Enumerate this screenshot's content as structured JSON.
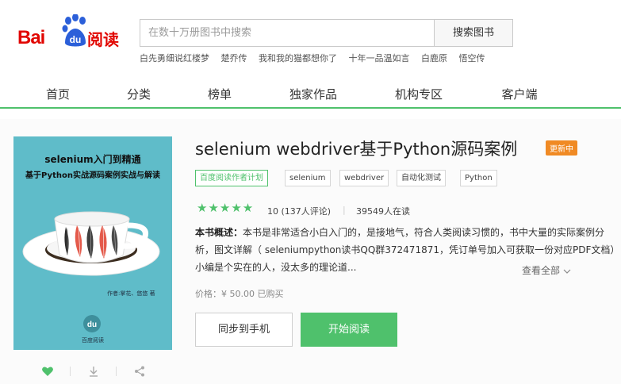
{
  "logo": {
    "bai": "Bai",
    "du": "du",
    "yuedu": "阅读"
  },
  "search": {
    "placeholder": "在数十万册图书中搜索",
    "button_label": "搜索图书"
  },
  "hot_searches": [
    "白先勇细说红楼梦",
    "楚乔传",
    "我和我的猫都想你了",
    "十年一品温如言",
    "白鹿原",
    "悟空传"
  ],
  "nav": {
    "items": [
      "首页",
      "分类",
      "榜单",
      "独家作品",
      "机构专区",
      "客户端"
    ]
  },
  "cover": {
    "title": "selenium入门到精通",
    "subtitle": "基于Python实战源码案例实战与解读",
    "author": "作者:掌花、悠悠 著",
    "publisher": "百度阅读"
  },
  "book": {
    "title": "selenium webdriver基于Python源码案例",
    "badge": "更新中",
    "tags": [
      "百度阅读作者计划",
      "selenium",
      "webdriver",
      "自动化测试",
      "Python"
    ],
    "stars": "★★★★★",
    "score": "10 (137人评论)",
    "separator": "|",
    "readers": "39549人在读",
    "summary_label": "本书概述：",
    "summary_text": "本书是非常适合小白入门的，是接地气，符合人类阅读习惯的，书中大量的实际案例分析，图文详解（ seleniumpython读书QQ群372471871，凭订单号加入可获取一份对应PDF文档）小编是个实在的人，没太多的理论道...",
    "more_label": "查看全部",
    "price": "价格：¥ 50.00   已购买"
  },
  "buttons": {
    "sync": "同步到手机",
    "read": "开始阅读"
  },
  "colors": {
    "brand_red": "#e10601",
    "accent_green": "#4fc16c",
    "badge_orange": "#f08a24",
    "cover_teal": "#5fbcc9"
  },
  "icons": [
    "paw-icon",
    "heart-icon",
    "download-icon",
    "share-icon",
    "chevron-down-icon"
  ]
}
